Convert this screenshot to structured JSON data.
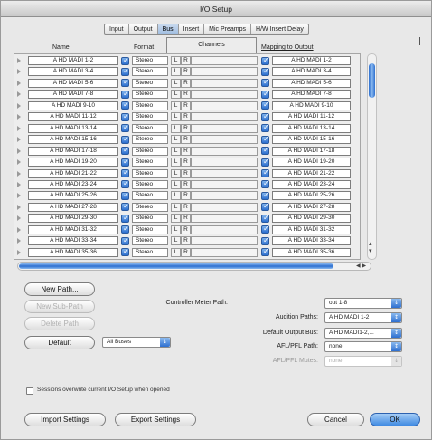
{
  "window": {
    "title": "I/O Setup"
  },
  "tabs": [
    {
      "label": "Input",
      "active": false
    },
    {
      "label": "Output",
      "active": false
    },
    {
      "label": "Bus",
      "active": true
    },
    {
      "label": "Insert",
      "active": false
    },
    {
      "label": "Mic Preamps",
      "active": false
    },
    {
      "label": "H/W Insert Delay",
      "active": false
    }
  ],
  "columns": {
    "name": "Name",
    "format": "Format",
    "channels": "Channels",
    "mapping": "Mapping to Output"
  },
  "rows": [
    {
      "name": "A HD MADI 1-2",
      "format": "Stereo",
      "ch_l": "L",
      "ch_r": "R",
      "mapping": "A HD MADI 1-2"
    },
    {
      "name": "A HD MADI 3-4",
      "format": "Stereo",
      "ch_l": "L",
      "ch_r": "R",
      "mapping": "A HD MADI 3-4"
    },
    {
      "name": "A HD MADI 5-6",
      "format": "Stereo",
      "ch_l": "L",
      "ch_r": "R",
      "mapping": "A HD MADI 5-6"
    },
    {
      "name": "A HD MADI 7-8",
      "format": "Stereo",
      "ch_l": "L",
      "ch_r": "R",
      "mapping": "A HD MADI 7-8"
    },
    {
      "name": "A HD MADI 9-10",
      "format": "Stereo",
      "ch_l": "L",
      "ch_r": "R",
      "mapping": "A HD MADI 9-10"
    },
    {
      "name": "A HD MADI 11-12",
      "format": "Stereo",
      "ch_l": "L",
      "ch_r": "R",
      "mapping": "A HD MADI 11-12"
    },
    {
      "name": "A HD MADI 13-14",
      "format": "Stereo",
      "ch_l": "L",
      "ch_r": "R",
      "mapping": "A HD MADI 13-14"
    },
    {
      "name": "A HD MADI 15-16",
      "format": "Stereo",
      "ch_l": "L",
      "ch_r": "R",
      "mapping": "A HD MADI 15-16"
    },
    {
      "name": "A HD MADI 17-18",
      "format": "Stereo",
      "ch_l": "L",
      "ch_r": "R",
      "mapping": "A HD MADI 17-18"
    },
    {
      "name": "A HD MADI 19-20",
      "format": "Stereo",
      "ch_l": "L",
      "ch_r": "R",
      "mapping": "A HD MADI 19-20"
    },
    {
      "name": "A HD MADI 21-22",
      "format": "Stereo",
      "ch_l": "L",
      "ch_r": "R",
      "mapping": "A HD MADI 21-22"
    },
    {
      "name": "A HD MADI 23-24",
      "format": "Stereo",
      "ch_l": "L",
      "ch_r": "R",
      "mapping": "A HD MADI 23-24"
    },
    {
      "name": "A HD MADI 25-26",
      "format": "Stereo",
      "ch_l": "L",
      "ch_r": "R",
      "mapping": "A HD MADI 25-26"
    },
    {
      "name": "A HD MADI 27-28",
      "format": "Stereo",
      "ch_l": "L",
      "ch_r": "R",
      "mapping": "A HD MADI 27-28"
    },
    {
      "name": "A HD MADI 29-30",
      "format": "Stereo",
      "ch_l": "L",
      "ch_r": "R",
      "mapping": "A HD MADI 29-30"
    },
    {
      "name": "A HD MADI 31-32",
      "format": "Stereo",
      "ch_l": "L",
      "ch_r": "R",
      "mapping": "A HD MADI 31-32"
    },
    {
      "name": "A HD MADI 33-34",
      "format": "Stereo",
      "ch_l": "L",
      "ch_r": "R",
      "mapping": "A HD MADI 33-34"
    },
    {
      "name": "A HD MADI 35-36",
      "format": "Stereo",
      "ch_l": "L",
      "ch_r": "R",
      "mapping": "A HD MADI 35-36"
    }
  ],
  "paths": {
    "new_path": "New Path...",
    "new_sub_path": "New Sub-Path",
    "delete_path": "Delete Path",
    "default": "Default",
    "default_scope": "All Buses"
  },
  "settings": {
    "controller_meter_path": {
      "label": "Controller Meter Path:",
      "value": "out 1-8"
    },
    "audition_paths": {
      "label": "Audition Paths:",
      "value": "A HD MADI 1-2"
    },
    "default_output_bus": {
      "label": "Default Output Bus:",
      "value": "A HD MADI1-2,..."
    },
    "afl_pfl_path": {
      "label": "AFL/PFL Path:",
      "value": "none"
    },
    "afl_pfl_mutes": {
      "label": "AFL/PFL Mutes:",
      "value": "none"
    }
  },
  "sessions_overwrite": {
    "label": "Sessions overwrite current I/O Setup when opened",
    "checked": false
  },
  "footer": {
    "import": "Import Settings",
    "export": "Export Settings",
    "cancel": "Cancel",
    "ok": "OK"
  }
}
